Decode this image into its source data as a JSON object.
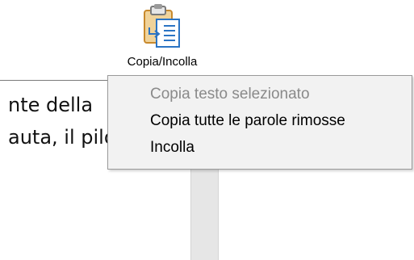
{
  "ribbon": {
    "paste_button": {
      "label": "Copia/Incolla",
      "icon": "clipboard-paste-icon",
      "accent": "#2b74c4",
      "clipboard_color": "#e0a13a"
    }
  },
  "context_menu": {
    "items": [
      {
        "label": "Copia testo selezionato",
        "enabled": false
      },
      {
        "label": "Copia tutte le parole rimosse",
        "enabled": true
      },
      {
        "label": "Incolla",
        "enabled": true
      }
    ]
  },
  "document": {
    "lines": [
      "nte della",
      "auta, il pilota"
    ]
  }
}
